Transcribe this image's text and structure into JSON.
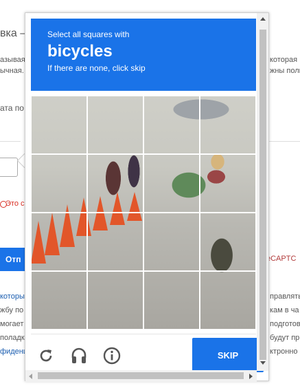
{
  "background": {
    "title_fragment": "вка –",
    "lines": [
      "азывая",
      "ычная.",
      "ата по",
      "которая",
      "жны полн"
    ],
    "error_text": "Это с",
    "submit_fragment": "Отп",
    "recaptcha_fragment": "eCAPTC",
    "footer_left": [
      "которы",
      "жбу по",
      "могает",
      "поладк",
      "фиденц"
    ],
    "footer_right": [
      "правлять",
      "кам в ча",
      "подготов",
      "будут пр",
      "ктронно"
    ]
  },
  "captcha": {
    "instruction_small": "Select all squares with",
    "instruction_object": "bicycles",
    "instruction_sub": "If there are none, click skip",
    "grid": {
      "rows": 4,
      "cols": 4
    },
    "skip_label": "SKIP",
    "icons": [
      "reload-icon",
      "audio-icon",
      "info-icon"
    ],
    "accent_color": "#1a73e8"
  }
}
